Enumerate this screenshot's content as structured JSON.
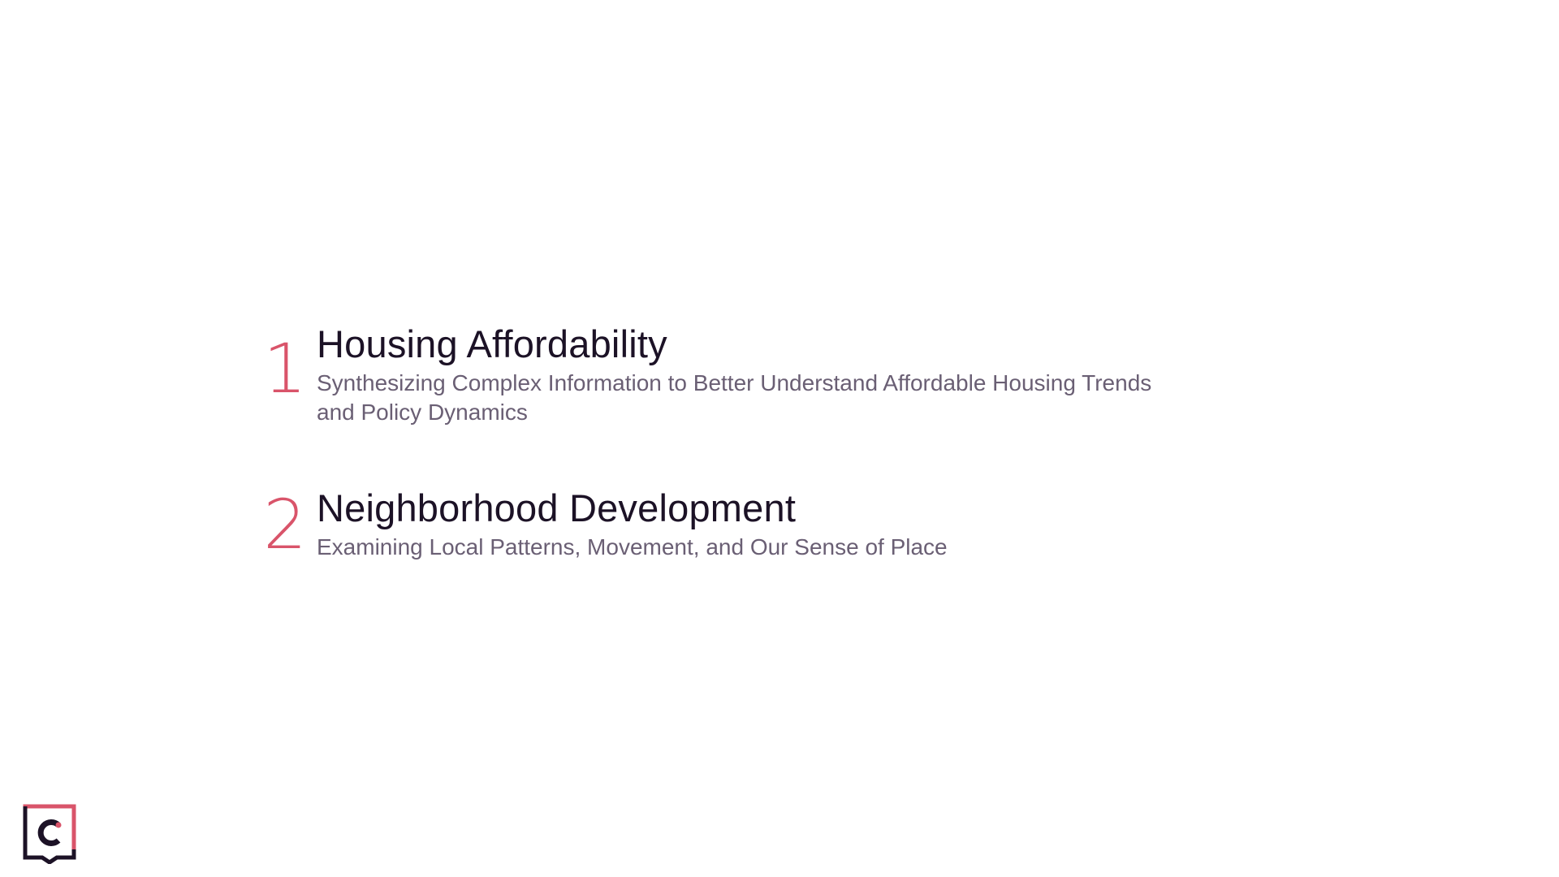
{
  "colors": {
    "accent": "#d9546a",
    "title": "#1c1226",
    "subtitle": "#6a5f74",
    "logo_dark": "#1c1226"
  },
  "agenda": {
    "items": [
      {
        "number": "1",
        "title": "Housing Affordability",
        "subtitle": "Synthesizing Complex Information to Better Understand Affordable Housing Trends and Policy Dynamics"
      },
      {
        "number": "2",
        "title": "Neighborhood Development",
        "subtitle": "Examining Local Patterns, Movement, and Our Sense of Place"
      }
    ]
  },
  "logo": {
    "icon": "speech-bubble-c-logo-icon"
  }
}
